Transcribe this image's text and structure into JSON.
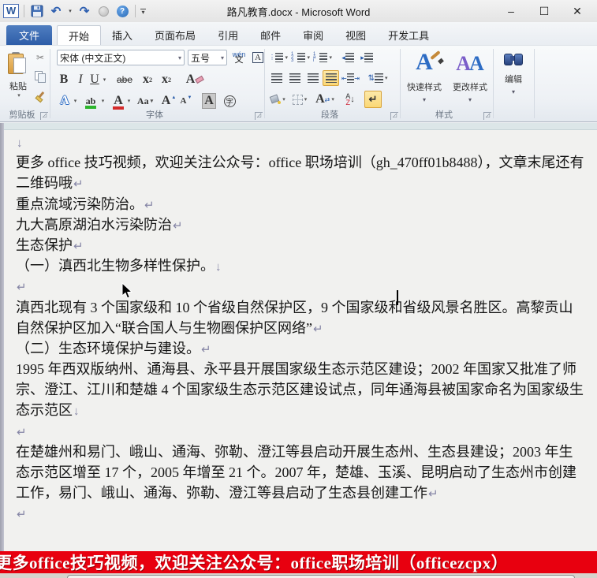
{
  "titlebar": {
    "title": "路凡教育.docx - Microsoft Word",
    "window_controls": {
      "minimize": "–",
      "maximize": "☐",
      "close": "✕"
    }
  },
  "tabs": {
    "file_label": "文件",
    "items": [
      "开始",
      "插入",
      "页面布局",
      "引用",
      "邮件",
      "审阅",
      "视图",
      "开发工具"
    ],
    "active": "开始"
  },
  "ribbon": {
    "clipboard": {
      "label": "剪贴板",
      "paste_label": "粘贴"
    },
    "font": {
      "label": "字体",
      "font_name": "宋体 (中文正文)",
      "font_size": "五号",
      "bold": "B",
      "italic": "I",
      "underline": "U",
      "strikethrough": "abe",
      "subscript_base": "x",
      "subscript_mark": "2",
      "superscript_base": "x",
      "superscript_mark": "2",
      "clear_format": "A",
      "text_effects": "A",
      "highlight": "ab",
      "font_color": "A",
      "change_case": "Aa",
      "grow_font": "A",
      "grow_arrow": "▲",
      "shrink_font": "A",
      "shrink_arrow": "▼",
      "char_shading": "A",
      "enclose_char": "字",
      "phonetic_top": "wén",
      "phonetic_bottom": "文"
    },
    "paragraph": {
      "label": "段落",
      "bullet_dots": "∶",
      "number_col": "1\n2",
      "multi_col": "₁⒜",
      "sort_top": "A",
      "sort_mid": "Z",
      "sort_arrow": "↓",
      "show_mark": "↵",
      "spacing_arrows": "⇅"
    },
    "styles": {
      "label": "样式",
      "quick_styles": "快速样式",
      "change_styles": "更改样式",
      "quick_icon": "A",
      "change_icon_1": "A",
      "change_icon_2": "A"
    },
    "editing": {
      "label": "编辑"
    },
    "collapse_glyph": "˄"
  },
  "icons": {
    "word_logo": "W",
    "undo_glyph": "↶",
    "redo_glyph": "↷",
    "help_glyph": "?",
    "dropdown": "▾",
    "launcher_arrow": "◿",
    "pilcrow_mark": "↵",
    "down_mark": "↓"
  },
  "document": {
    "lines": [
      {
        "text": "",
        "mark": "down"
      },
      {
        "text": "更多 office 技巧视频，欢迎关注公众号：office 职场培训（gh_470ff01b8488），文章末尾还有",
        "mark": ""
      },
      {
        "text": "二维码哦",
        "mark": "pilcrow"
      },
      {
        "text": "重点流域污染防治。",
        "mark": "pilcrow"
      },
      {
        "text": "九大高原湖泊水污染防治",
        "mark": "pilcrow"
      },
      {
        "text": "生态保护",
        "mark": "pilcrow"
      },
      {
        "text": "（一）滇西北生物多样性保护。",
        "mark": "down"
      },
      {
        "text": "",
        "mark": "pilcrow"
      },
      {
        "text": "滇西北现有 3 个国家级和 10 个省级自然保护区，9 个国家级和省级风景名胜区。高黎贡山",
        "mark": ""
      },
      {
        "text": "自然保护区加入“联合国人与生物圈保护区网络”",
        "mark": "pilcrow"
      },
      {
        "text": "（二）生态环境保护与建设。",
        "mark": "pilcrow"
      },
      {
        "text": "1995 年西双版纳州、通海县、永平县开展国家级生态示范区建设；2002 年国家又批准了师",
        "mark": ""
      },
      {
        "text": "宗、澄江、江川和楚雄 4 个国家级生态示范区建设试点，同年通海县被国家命名为国家级生",
        "mark": ""
      },
      {
        "text": "态示范区",
        "mark": "down"
      },
      {
        "text": "",
        "mark": "pilcrow"
      },
      {
        "text": "在楚雄州和易门、峨山、通海、弥勒、澄江等县启动开展生态州、生态县建设；2003 年生",
        "mark": ""
      },
      {
        "text": "态示范区增至 17 个，2005 年增至 21 个。2007 年，楚雄、玉溪、昆明启动了生态州市创建",
        "mark": ""
      },
      {
        "text": "工作，易门、峨山、通海、弥勒、澄江等县启动了生态县创建工作",
        "mark": "pilcrow"
      },
      {
        "text": "",
        "mark": "pilcrow"
      }
    ]
  },
  "banner": {
    "text": "更多office技巧视频，欢迎关注公众号：office职场培训（officezcpx）",
    "bg": "#e8000f",
    "fg": "#ffffff"
  },
  "colors": {
    "file_tab_blue": "#2e5da8",
    "active_highlight_orange": "#fbd876",
    "highlight_green": "#2db52d",
    "font_color_red": "#d42a2a",
    "page_bg": "#f1f1ef",
    "mark_gray": "#8585a5"
  }
}
